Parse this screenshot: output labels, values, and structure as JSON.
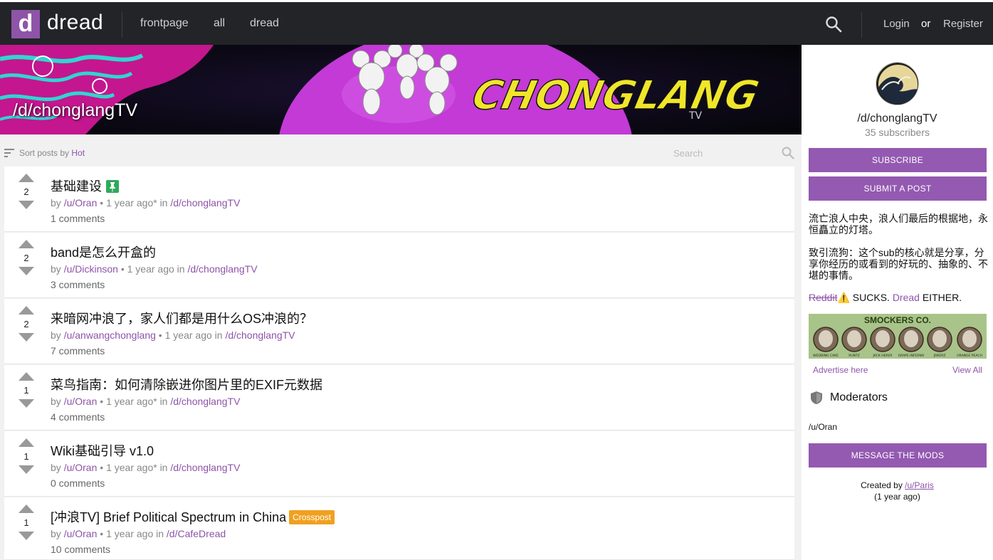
{
  "nav": {
    "logo_letter": "d",
    "logo_text": "dread",
    "links": [
      "frontpage",
      "all",
      "dread"
    ],
    "login": "Login",
    "or": "or",
    "register": "Register"
  },
  "banner": {
    "title": "/d/chonglangTV",
    "art_text": "CHONGLANG",
    "art_sub": "TV"
  },
  "sort": {
    "label": "Sort posts by ",
    "value": "Hot",
    "search_placeholder": "Search"
  },
  "posts": [
    {
      "score": "2",
      "title": "基础建设",
      "by": "by ",
      "user": "/u/Oran",
      "time": " • 1 year ago* in ",
      "sub": "/d/chonglangTV",
      "comments": "1 comments",
      "badge": "pin"
    },
    {
      "score": "2",
      "title": "band是怎么开盒的",
      "by": "by ",
      "user": "/u/Dickinson",
      "time": " • 1 year ago in ",
      "sub": "/d/chonglangTV",
      "comments": "3 comments",
      "badge": ""
    },
    {
      "score": "2",
      "title": "来暗网冲浪了，家人们都是用什么OS冲浪的？",
      "by": "by ",
      "user": "/u/anwangchonglang",
      "time": " • 1 year ago in ",
      "sub": "/d/chonglangTV",
      "comments": "7 comments",
      "badge": ""
    },
    {
      "score": "1",
      "title": "菜鸟指南：如何清除嵌进你图片里的EXIF元数据",
      "by": "by ",
      "user": "/u/Oran",
      "time": " • 1 year ago* in ",
      "sub": "/d/chonglangTV",
      "comments": "4 comments",
      "badge": ""
    },
    {
      "score": "1",
      "title": "Wiki基础引导 v1.0",
      "by": "by ",
      "user": "/u/Oran",
      "time": " • 1 year ago* in ",
      "sub": "/d/chonglangTV",
      "comments": "0 comments",
      "badge": ""
    },
    {
      "score": "1",
      "title": "[冲浪TV] Brief Political Spectrum in China",
      "by": "by ",
      "user": "/u/Oran",
      "time": " • 1 year ago in ",
      "sub": "/d/CafeDread",
      "comments": "10 comments",
      "badge": "Crosspost"
    }
  ],
  "sidebar": {
    "name": "/d/chonglangTV",
    "subscribers": "35 subscribers",
    "subscribe": "SUBSCRIBE",
    "submit": "SUBMIT A POST",
    "desc1": "流亡浪人中央，浪人们最后的根据地，永恒矗立的灯塔。",
    "desc2": "致引流狗：这个sub的核心就是分享，分享你经历的或看到的好玩的、抽象的、不堪的事情。",
    "reddit": "Reddit",
    "warn": "⚠️",
    "sucks": " SUCKS. ",
    "dread": "Dread",
    "either": " EITHER.",
    "ad_title": "SMOCKERS CO.",
    "ad_items": [
      "WEDDING CAKE",
      "RUNTZ",
      "JACK HERER",
      "GRAPE INFERNO",
      "JOKERZ",
      "ORANGE PEACH"
    ],
    "advertise": "Advertise here",
    "view_all": "View All",
    "moderators": "Moderators",
    "mod_user": "/u/Oran",
    "message": "MESSAGE THE MODS",
    "created_by": "Created by ",
    "creator": "/u/Paris",
    "created_time": "(1 year ago)"
  },
  "colors": {
    "accent": "#8e54a8",
    "topbar": "#222428",
    "button": "#9459b1",
    "crosspost": "#f0a020",
    "pin": "#2eaa5c"
  }
}
